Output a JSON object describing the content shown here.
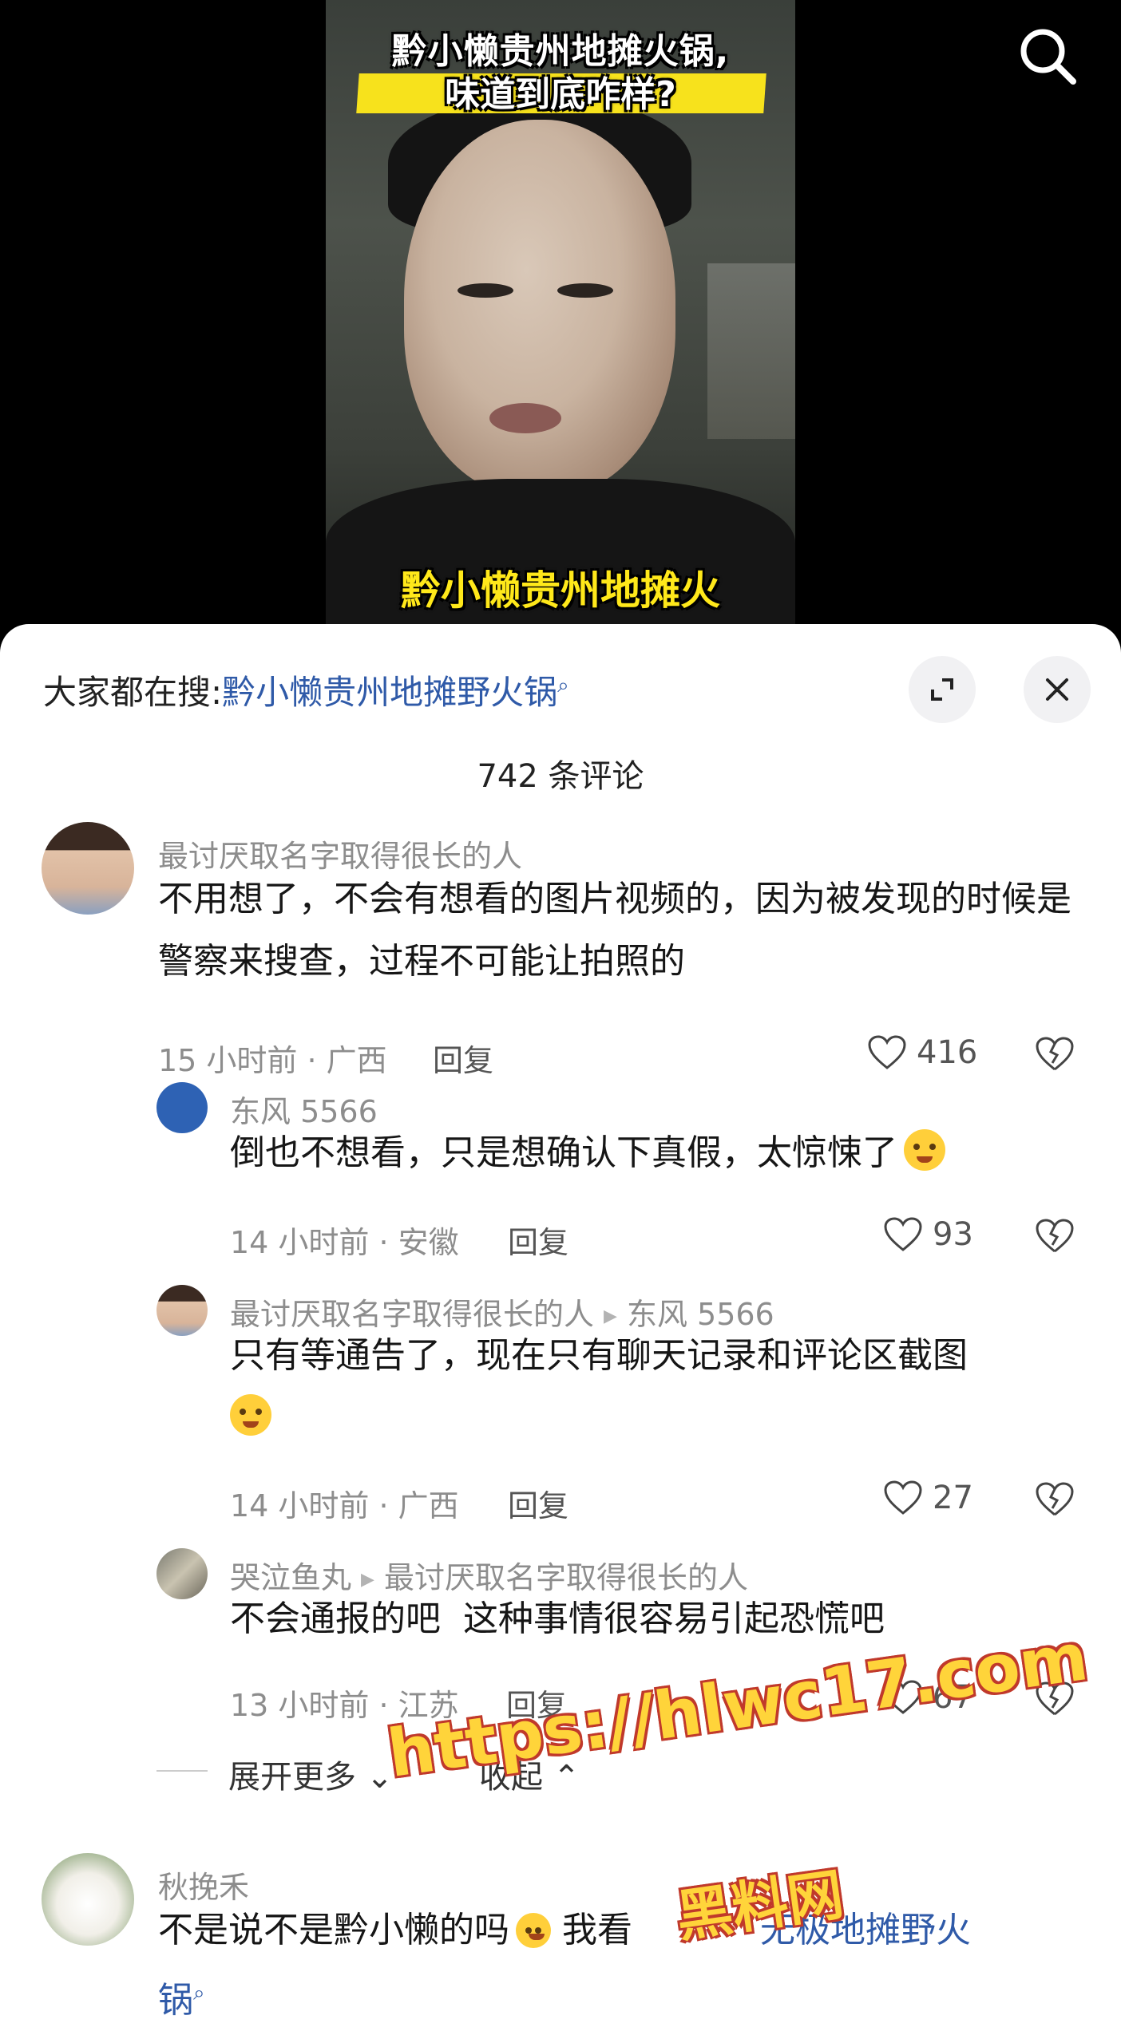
{
  "video": {
    "caption_line1": "黔小懒贵州地摊火锅,",
    "caption_line2": "味道到底咋样?",
    "subtitle": "黔小懒贵州地摊火",
    "search_icon": "search-icon"
  },
  "sheet": {
    "search_prefix": "大家都在搜:",
    "search_link": "黔小懒贵州地摊野火锅",
    "search_link_icon": "search-icon",
    "expand_icon": "expand-icon",
    "close_icon": "close-icon",
    "comment_count": "742 条评论"
  },
  "comments": [
    {
      "user": "最讨厌取名字取得很长的人",
      "text": "不用想了，不会有想看的图片视频的，因为被发现的时候是警察来搜查，过程不可能让拍照的",
      "meta": "15 小时前 · 广西",
      "reply": "回复",
      "likes": "416"
    },
    {
      "user": "东风 5566",
      "text": "倒也不想看，只是想确认下真假，太惊悚了",
      "emoji": "flushed-emoji",
      "meta": "14 小时前 · 安徽",
      "reply": "回复",
      "likes": "93"
    },
    {
      "user": "最讨厌取名字取得很长的人",
      "reply_to": "东风 5566",
      "text": "只有等通告了，现在只有聊天记录和评论区截图",
      "emoji": "laughing-emoji",
      "meta": "14 小时前 · 广西",
      "reply": "回复",
      "likes": "27"
    },
    {
      "user": "哭泣鱼丸",
      "reply_to": "最讨厌取名字取得很长的人",
      "text": "不会通报的吧  这种事情很容易引起恐慌吧",
      "meta": "13 小时前 · 江苏",
      "reply": "回复",
      "likes": "67"
    },
    {
      "user": "秋挽禾",
      "text_a": "不是说不是黔小懒的吗",
      "emoji": "shocked-emoji",
      "text_b": "我看",
      "text_c": "无极地摊野火",
      "text_d": "锅"
    }
  ],
  "thread": {
    "expand_more": "展开更多",
    "collapse": "收起"
  },
  "watermark": {
    "url": "https://hlwc17.com",
    "name": "黑料网"
  }
}
